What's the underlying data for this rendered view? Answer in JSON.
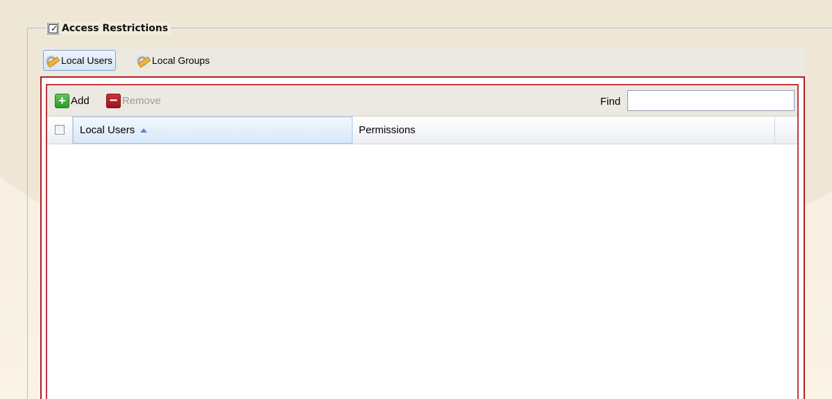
{
  "section": {
    "legend_label": "Access Restrictions",
    "legend_checked": true
  },
  "tabs": [
    {
      "label": "Local Users",
      "icon": "user-config-icon",
      "active": true
    },
    {
      "label": "Local Groups",
      "icon": "group-config-icon",
      "active": false
    }
  ],
  "toolbar": {
    "add_label": "Add",
    "add_icon": "plus-icon",
    "remove_label": "Remove",
    "remove_icon": "minus-icon",
    "remove_enabled": false,
    "find_label": "Find",
    "find_value": ""
  },
  "grid": {
    "columns": [
      {
        "label": "Local Users",
        "sorted": "ascending"
      },
      {
        "label": "Permissions"
      }
    ],
    "rows": []
  },
  "colors": {
    "panel_border": "#b01c25",
    "active_tab_border": "#7da2ce",
    "sorted_header_bg": "#d9e7f8",
    "add_icon": "#2c9a2a",
    "remove_icon": "#9a1218"
  }
}
